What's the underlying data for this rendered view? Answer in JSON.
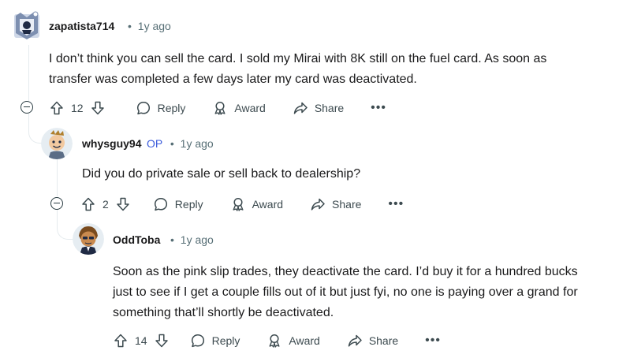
{
  "comments": [
    {
      "username": "zapatista714",
      "op_tag": "",
      "separator": "•",
      "time": "1y ago",
      "body_lines": [
        "I don’t think you can sell the card. I sold my Mirai with 8K still on the fuel card. As soon as",
        "transfer was completed a few days later my card was deactivated."
      ],
      "score": "12",
      "reply_label": "Reply",
      "award_label": "Award",
      "share_label": "Share",
      "more_label": "•••"
    },
    {
      "username": "whysguy94",
      "op_tag": "OP",
      "separator": "•",
      "time": "1y ago",
      "body_lines": [
        "Did you do private sale or sell back to dealership?"
      ],
      "score": "2",
      "reply_label": "Reply",
      "award_label": "Award",
      "share_label": "Share",
      "more_label": "•••"
    },
    {
      "username": "OddToba",
      "op_tag": "",
      "separator": "•",
      "time": "1y ago",
      "body_lines": [
        "Soon as the pink slip trades, they deactivate the card. I’d buy it for a hundred bucks",
        "just to see if I get a couple fills out of it but just fyi, no one is paying over a grand for",
        "something that’ll shortly be deactivated."
      ],
      "score": "14",
      "reply_label": "Reply",
      "award_label": "Award",
      "share_label": "Share",
      "more_label": "•••"
    }
  ]
}
